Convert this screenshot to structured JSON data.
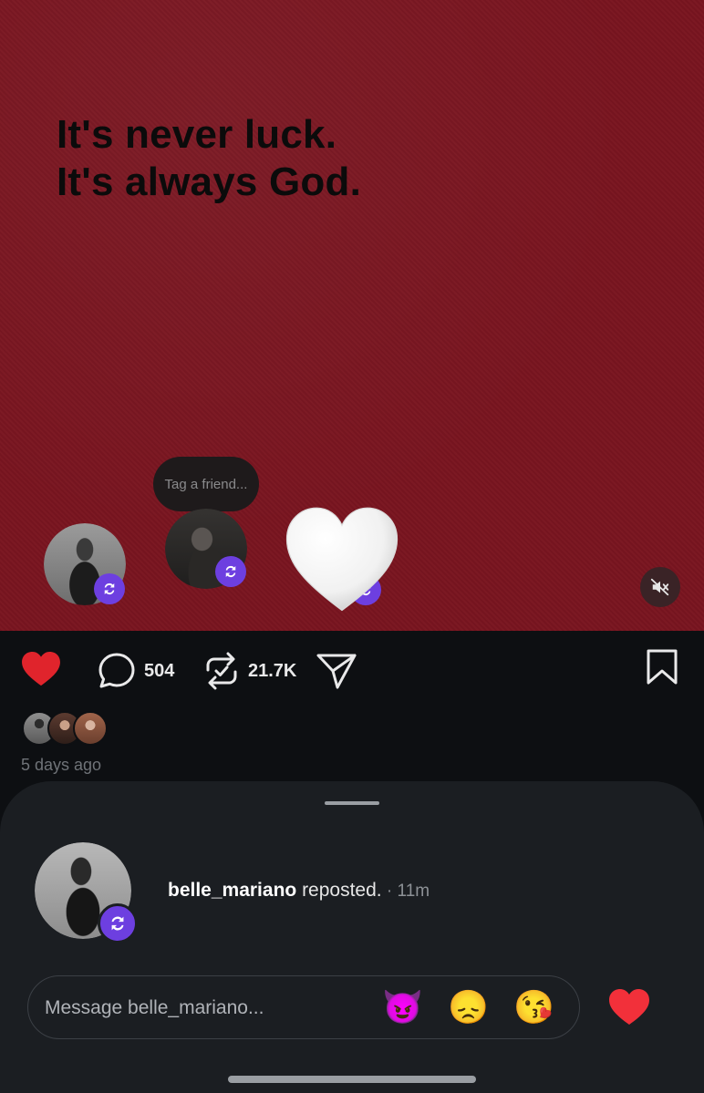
{
  "post": {
    "quote_line_1": "It's never luck.",
    "quote_line_2": "It's always God.",
    "tag_placeholder": "Tag a friend...",
    "mute_icon": "speaker-muted-icon"
  },
  "actions": {
    "like_icon": "heart-filled-icon",
    "like_color": "#e0242c",
    "comment_icon": "comment-bubble-icon",
    "comment_count": "504",
    "repost_icon": "repost-icon",
    "repost_count": "21.7K",
    "share_icon": "paper-plane-icon",
    "save_icon": "bookmark-icon"
  },
  "meta": {
    "time_ago": "5 days ago"
  },
  "sheet": {
    "username": "belle_mariano",
    "action_text": " reposted.",
    "separator": " · ",
    "time": "11m",
    "message_placeholder": "Message belle_mariano...",
    "quick_reactions": [
      "😈",
      "😞",
      "😘"
    ],
    "send_icon": "heart-filled-icon"
  },
  "colors": {
    "accent_purple": "#6d3fe0",
    "post_background": "#7a1520",
    "heart_red": "#e0242c"
  }
}
